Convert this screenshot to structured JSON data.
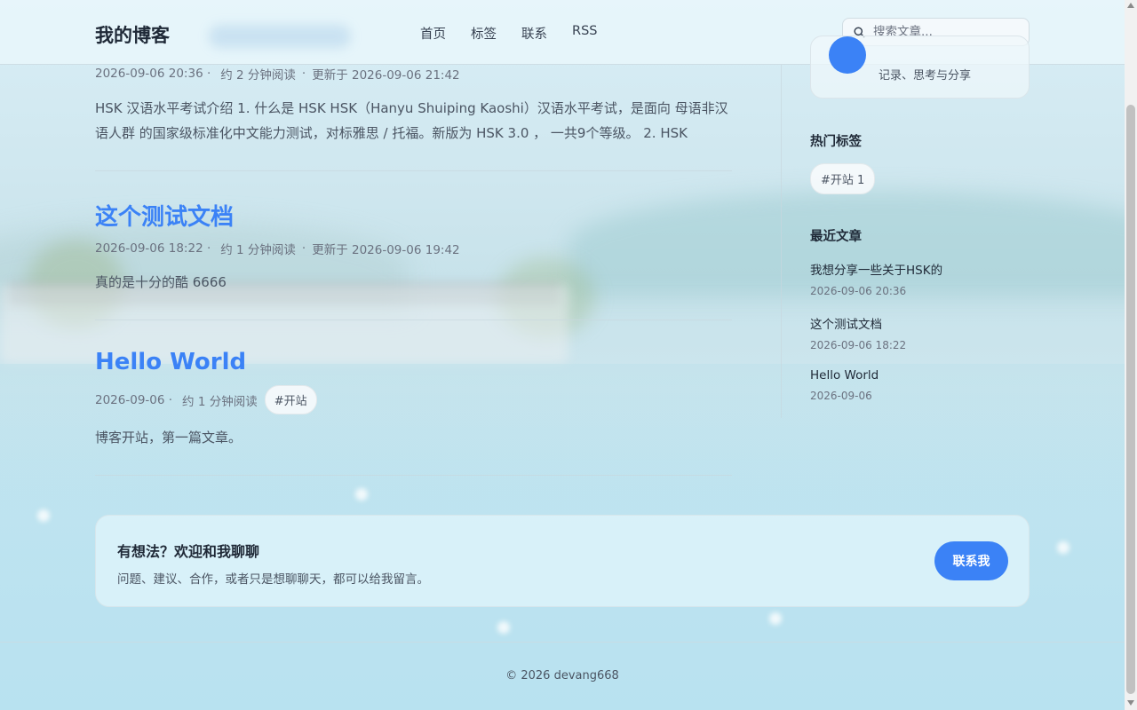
{
  "header": {
    "logo": "我的博客",
    "nav": [
      "首页",
      "标签",
      "联系",
      "RSS"
    ],
    "search_placeholder": "搜索文章..."
  },
  "posts": [
    {
      "title": "",
      "date": "2026-09-06 20:36 ·",
      "read_time": "约 2 分钟阅读",
      "updated": "更新于 2026-09-06 21:42",
      "excerpt": "HSK 汉语水平考试介绍 1. 什么是 HSK HSK（Hanyu Shuiping Kaoshi）汉语水平考试，是面向 母语非汉语人群 的国家级标准化中文能力测试，对标雅思 / 托福。新版为 HSK 3.0 ， 一共9个等级。 2. HSK"
    },
    {
      "title": "这个测试文档",
      "date": "2026-09-06 18:22 ·",
      "read_time": "约 1 分钟阅读",
      "updated": "更新于 2026-09-06 19:42",
      "excerpt": "真的是十分的酷 6666"
    },
    {
      "title": "Hello World",
      "date": "2026-09-06 ·",
      "read_time": "约 1 分钟阅读",
      "tag": "#开站",
      "excerpt": "博客开站，第一篇文章。"
    }
  ],
  "sidebar": {
    "profile_desc": "记录、思考与分享",
    "hot_tags_heading": "热门标签",
    "hot_tags": [
      "#开站 1"
    ],
    "recent_heading": "最近文章",
    "recent": [
      {
        "title": "我想分享一些关于HSK的",
        "date": "2026-09-06 20:36"
      },
      {
        "title": "这个测试文档",
        "date": "2026-09-06 18:22"
      },
      {
        "title": "Hello World",
        "date": "2026-09-06"
      }
    ]
  },
  "contact": {
    "heading": "有想法？欢迎和我聊聊",
    "description": "问题、建议、合作，或者只是想聊聊天，都可以给我留言。",
    "button": "联系我"
  },
  "footer": {
    "copyright": "© 2026 devang668"
  },
  "colors": {
    "accent": "#3b82f6"
  }
}
